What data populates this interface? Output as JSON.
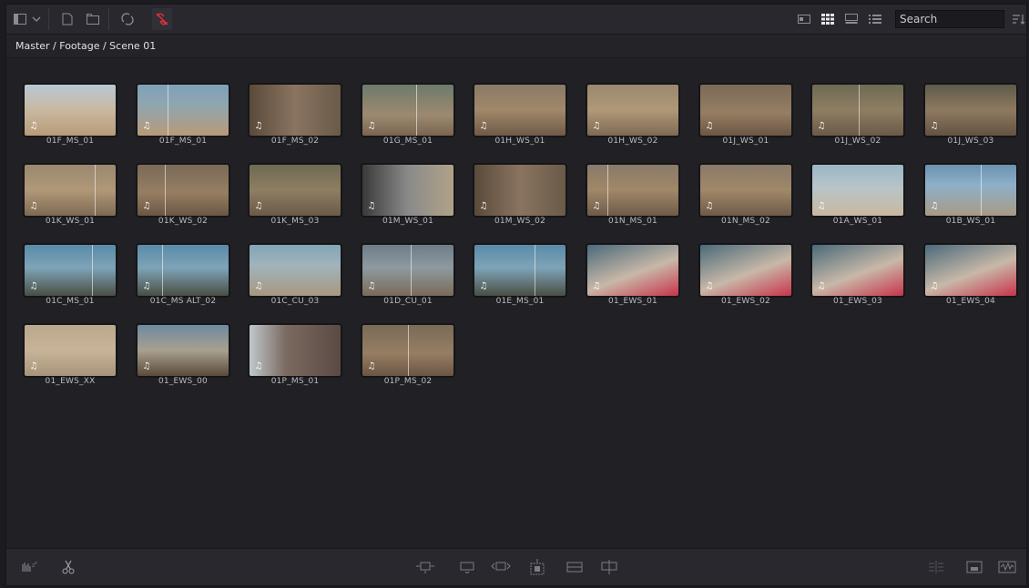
{
  "toolbar": {
    "search_placeholder": "Search",
    "icons": [
      "panel-toggle-icon",
      "chevron-down-icon",
      "new-clip-icon",
      "new-bin-icon",
      "sync-icon",
      "unlink-icon",
      "metadata-view-icon",
      "thumbnail-view-icon",
      "filmstrip-view-icon",
      "list-view-icon",
      "sort-icon"
    ],
    "accent_color": "#e0303a"
  },
  "breadcrumb": "Master / Footage / Scene 01",
  "clips": [
    {
      "name": "01F_MS_01"
    },
    {
      "name": "01F_MS_01"
    },
    {
      "name": "01F_MS_02"
    },
    {
      "name": "01G_MS_01"
    },
    {
      "name": "01H_WS_01"
    },
    {
      "name": "01H_WS_02"
    },
    {
      "name": "01J_WS_01"
    },
    {
      "name": "01J_WS_02"
    },
    {
      "name": "01J_WS_03"
    },
    {
      "name": "01K_WS_01"
    },
    {
      "name": "01K_WS_02"
    },
    {
      "name": "01K_MS_03"
    },
    {
      "name": "01M_WS_01"
    },
    {
      "name": "01M_WS_02"
    },
    {
      "name": "01N_MS_01"
    },
    {
      "name": "01N_MS_02"
    },
    {
      "name": "01A_WS_01"
    },
    {
      "name": "01B_WS_01"
    },
    {
      "name": "01C_MS_01"
    },
    {
      "name": "01C_MS ALT_02"
    },
    {
      "name": "01C_CU_03"
    },
    {
      "name": "01D_CU_01"
    },
    {
      "name": "01E_MS_01"
    },
    {
      "name": "01_EWS_01"
    },
    {
      "name": "01_EWS_02"
    },
    {
      "name": "01_EWS_03"
    },
    {
      "name": "01_EWS_04"
    },
    {
      "name": "01_EWS_XX"
    },
    {
      "name": "01_EWS_00"
    },
    {
      "name": "01P_MS_01"
    },
    {
      "name": "01P_MS_02"
    }
  ],
  "bottombar": {
    "icons": [
      "audio-waveform-icon",
      "cut-icon",
      "insert-icon",
      "overwrite-icon",
      "replace-icon",
      "place-on-top-icon",
      "append-icon",
      "ripple-overwrite-icon",
      "split-view-icon",
      "viewer-icon",
      "waveform-view-icon"
    ]
  }
}
